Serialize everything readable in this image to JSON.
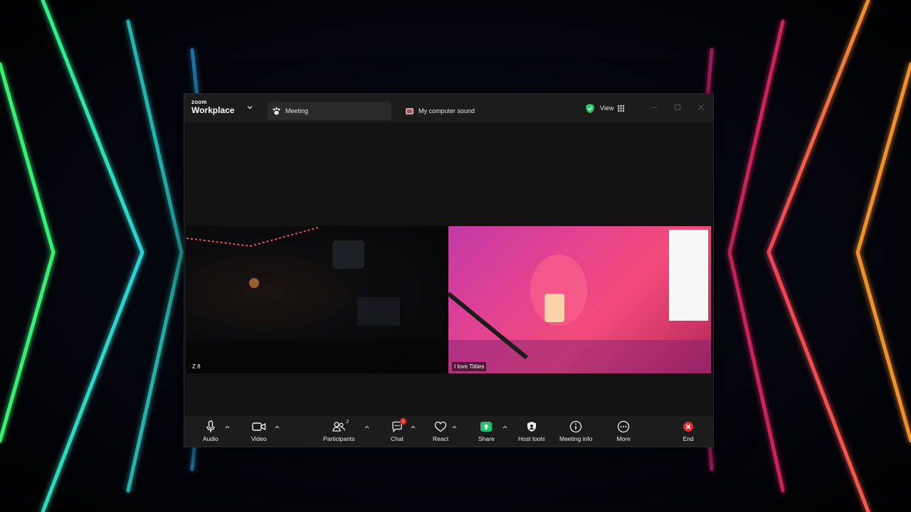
{
  "app": {
    "brand_small": "zoom",
    "brand_big": "Workplace"
  },
  "tabs": [
    {
      "label": "Meeting",
      "icon": "paw-icon",
      "active": true
    },
    {
      "label": "My computer sound",
      "icon": "speaker-icon",
      "active": false
    }
  ],
  "header": {
    "view_label": "View",
    "security_color": "#2ecc71"
  },
  "participants": [
    {
      "name": "Z 8"
    },
    {
      "name": "I love Titties"
    }
  ],
  "toolbar": {
    "audio": "Audio",
    "video": "Video",
    "participants": "Participants",
    "participants_count": "2",
    "chat": "Chat",
    "chat_badge": "1",
    "react": "React",
    "share": "Share",
    "host_tools": "Host tools",
    "meeting_info": "Meeting info",
    "more": "More",
    "end": "End"
  },
  "colors": {
    "share_green": "#1fc16b",
    "end_red": "#e52a2a",
    "badge_red": "#e52a2a"
  }
}
